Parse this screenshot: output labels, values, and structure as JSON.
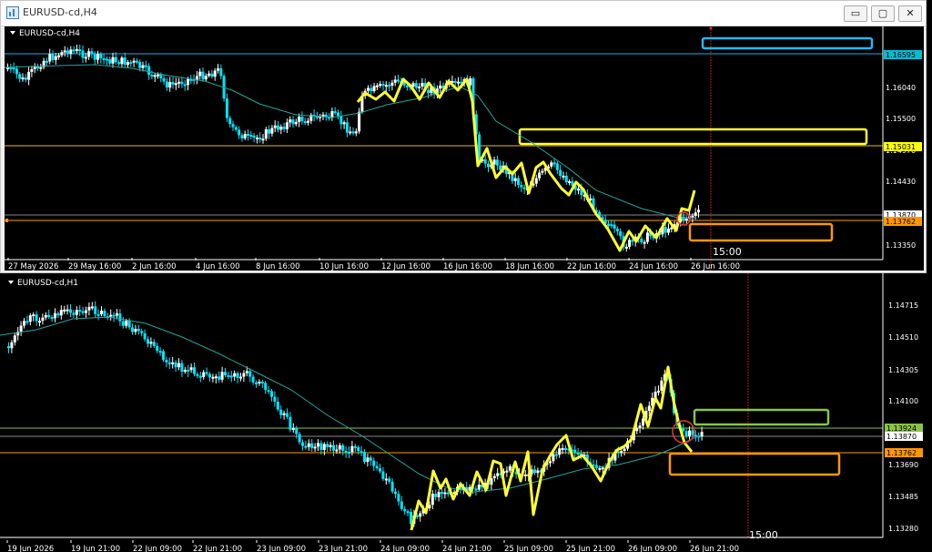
{
  "window": {
    "title": "EURUSD-cd,H4",
    "buttons": {
      "minimize": "▭",
      "restore": "▢",
      "close": "✕"
    }
  },
  "top_chart": {
    "label": "EURUSD-cd,H4",
    "price_axis": [
      "1.16040",
      "1.15500",
      "1.14970",
      "1.14430",
      "1.13870",
      "1.13350"
    ],
    "price_tags": [
      {
        "text": "1.16595",
        "color": "#00bcd4"
      },
      {
        "text": "1.15031",
        "color": "#ffff00"
      },
      {
        "text": "1.13870",
        "color": "#ffffff"
      },
      {
        "text": "1.13762",
        "color": "#ff9800"
      }
    ],
    "time_axis": [
      "27 May 2026",
      "29 May 16:00",
      "2 Jun 16:00",
      "4 Jun 16:00",
      "8 Jun 16:00",
      "10 Jun 16:00",
      "12 Jun 16:00",
      "16 Jun 16:00",
      "18 Jun 16:00",
      "22 Jun 16:00",
      "24 Jun 16:00",
      "26 Jun 16:00"
    ],
    "time_marker": "15:00"
  },
  "bottom_chart": {
    "label": "EURUSD-cd,H1",
    "price_axis": [
      "1.14715",
      "1.14510",
      "1.14305",
      "1.14100",
      "1.13690",
      "1.13485",
      "1.13280"
    ],
    "price_tags": [
      {
        "text": "1.13924",
        "color": "#8bc34a"
      },
      {
        "text": "1.13870",
        "color": "#ffffff"
      },
      {
        "text": "1.13762",
        "color": "#ff9800"
      }
    ],
    "time_axis": [
      "19 Jun 2026",
      "19 Jun 21:00",
      "22 Jun 09:00",
      "22 Jun 21:00",
      "23 Jun 09:00",
      "23 Jun 21:00",
      "24 Jun 09:00",
      "24 Jun 21:00",
      "25 Jun 09:00",
      "25 Jun 21:00",
      "26 Jun 09:00",
      "26 Jun 21:00"
    ],
    "time_marker": "15:00"
  },
  "colors": {
    "bull": "#ffffff",
    "bear": "#00e5ff",
    "ma": "#26a69a",
    "zigzag": "#ffff33"
  }
}
